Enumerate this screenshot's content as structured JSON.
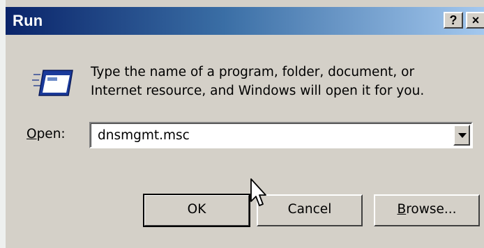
{
  "window": {
    "title": "Run",
    "help_glyph": "?",
    "close_glyph": "×"
  },
  "dialog": {
    "icon": "run-icon",
    "description_line1": "Type the name of a program, folder, document, or",
    "description_line2": "Internet resource, and Windows will open it for you.",
    "open_label_accel": "O",
    "open_label_rest": "pen:",
    "open_value": "dnsmgmt.msc"
  },
  "buttons": {
    "ok": "OK",
    "cancel": "Cancel",
    "browse_accel": "B",
    "browse_rest": "rowse..."
  },
  "colors": {
    "title_start": "#0a246a",
    "title_end": "#a6caf0",
    "face": "#d4d0c8"
  }
}
